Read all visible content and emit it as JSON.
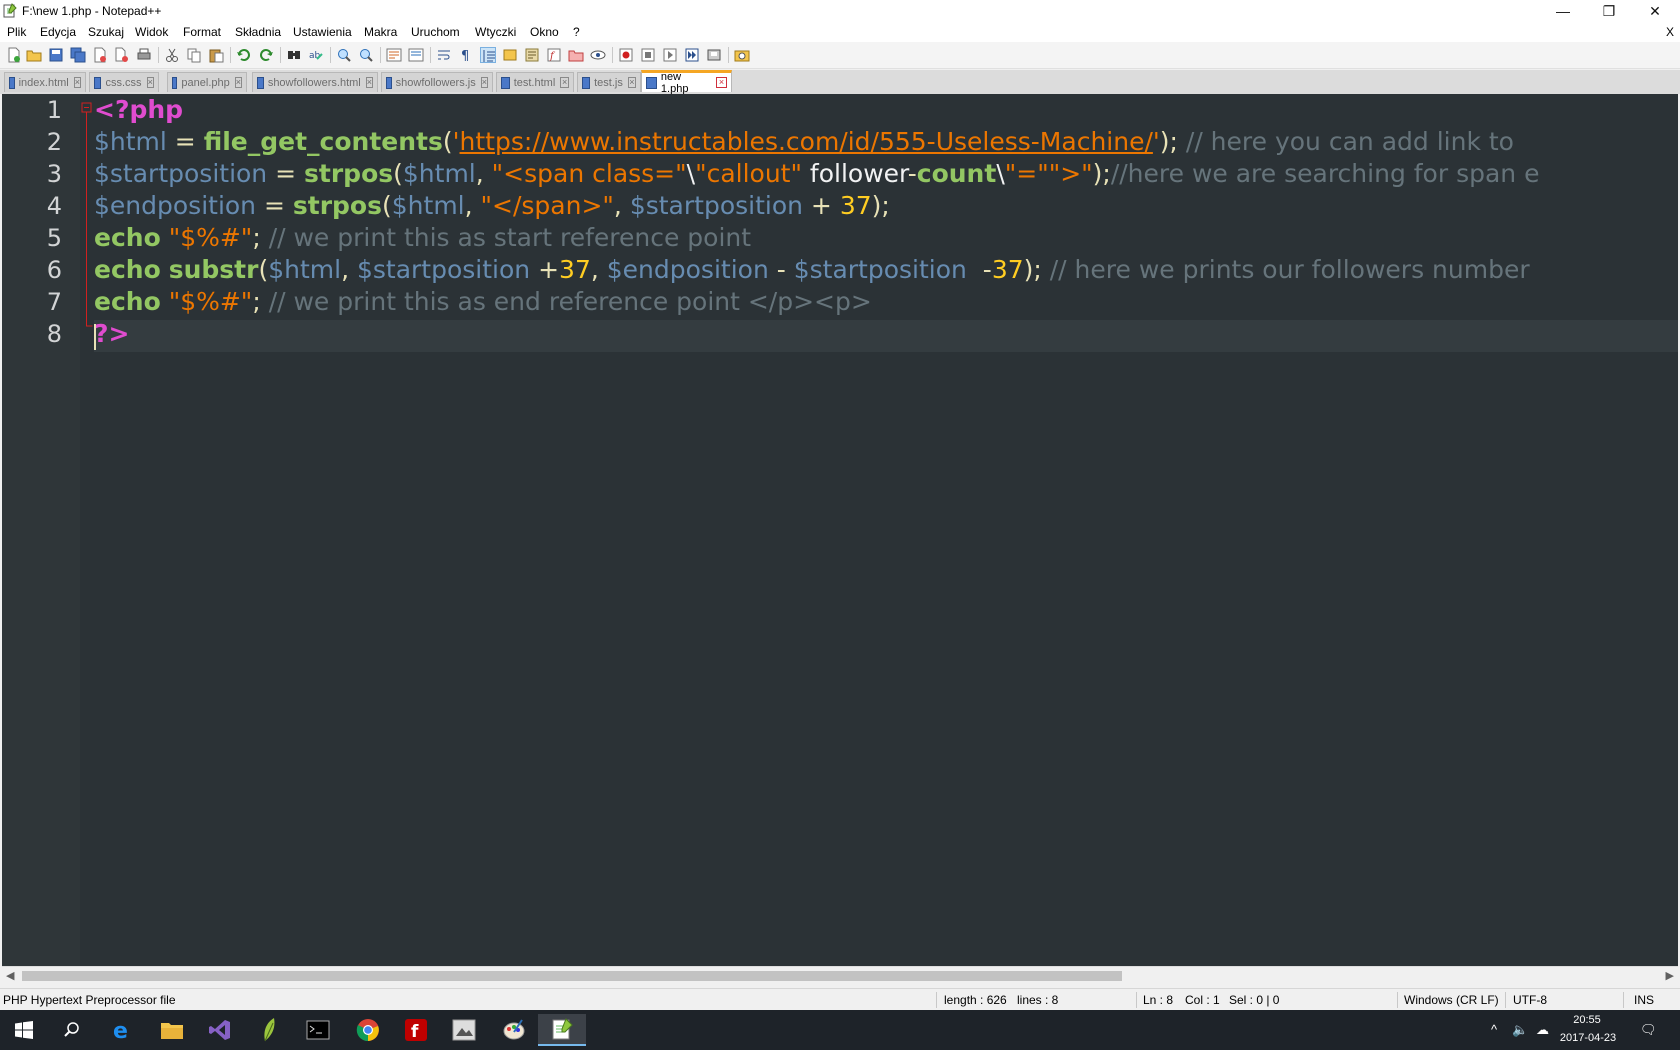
{
  "window": {
    "title": "F:\\new 1.php - Notepad++",
    "minimize_glyph": "—",
    "maximize_glyph": "❐",
    "close_glyph": "✕"
  },
  "menu": {
    "items": [
      "Plik",
      "Edycja",
      "Szukaj",
      "Widok",
      "Format",
      "Składnia",
      "Ustawienia",
      "Makra",
      "Uruchom",
      "Wtyczki",
      "Okno",
      "?"
    ],
    "close_label": "X"
  },
  "tabs": [
    {
      "label": "index.html",
      "active": false
    },
    {
      "label": "css.css",
      "active": false
    },
    {
      "label": "panel.php",
      "active": false
    },
    {
      "label": "showfollowers.html",
      "active": false
    },
    {
      "label": "showfollowers.js",
      "active": false
    },
    {
      "label": "test.html",
      "active": false
    },
    {
      "label": "test.js",
      "active": false
    },
    {
      "label": "new 1.php",
      "active": true
    }
  ],
  "editor": {
    "line_numbers": [
      "1",
      "2",
      "3",
      "4",
      "5",
      "6",
      "7",
      "8"
    ],
    "current_line": 8,
    "lines": [
      [
        {
          "t": "<?php",
          "c": "tag"
        }
      ],
      [
        {
          "t": "$html",
          "c": "var"
        },
        {
          "t": " = ",
          "c": "op"
        },
        {
          "t": "file_get_contents",
          "c": "kw"
        },
        {
          "t": "(",
          "c": "op"
        },
        {
          "t": "'",
          "c": "str"
        },
        {
          "t": "https://www.instructables.com/id/555-Useless-Machine/",
          "c": "url"
        },
        {
          "t": "'",
          "c": "str"
        },
        {
          "t": "); ",
          "c": "op"
        },
        {
          "t": "// here you can add link to",
          "c": "cmt"
        }
      ],
      [
        {
          "t": "$startposition",
          "c": "var"
        },
        {
          "t": " = ",
          "c": "op"
        },
        {
          "t": "strpos",
          "c": "kw"
        },
        {
          "t": "(",
          "c": "op"
        },
        {
          "t": "$html",
          "c": "var"
        },
        {
          "t": ", ",
          "c": "op"
        },
        {
          "t": "\"<span class=\"",
          "c": "str"
        },
        {
          "t": "\\",
          "c": "txt"
        },
        {
          "t": "\"callout\"",
          "c": "str"
        },
        {
          "t": " follower",
          "c": "txt"
        },
        {
          "t": "-",
          "c": "op"
        },
        {
          "t": "count",
          "c": "kw"
        },
        {
          "t": "\\",
          "c": "txt"
        },
        {
          "t": "\"=\"\">\"",
          "c": "str"
        },
        {
          "t": ");",
          "c": "op"
        },
        {
          "t": "//here we are searching for span e",
          "c": "cmt"
        }
      ],
      [
        {
          "t": "$endposition",
          "c": "var"
        },
        {
          "t": " = ",
          "c": "op"
        },
        {
          "t": "strpos",
          "c": "kw"
        },
        {
          "t": "(",
          "c": "op"
        },
        {
          "t": "$html",
          "c": "var"
        },
        {
          "t": ", ",
          "c": "op"
        },
        {
          "t": "\"</span>\"",
          "c": "str"
        },
        {
          "t": ", ",
          "c": "op"
        },
        {
          "t": "$startposition",
          "c": "var"
        },
        {
          "t": " + ",
          "c": "op"
        },
        {
          "t": "37",
          "c": "num"
        },
        {
          "t": ");",
          "c": "op"
        }
      ],
      [
        {
          "t": "echo",
          "c": "kw"
        },
        {
          "t": " ",
          "c": "op"
        },
        {
          "t": "\"$%#\"",
          "c": "str"
        },
        {
          "t": "; ",
          "c": "op"
        },
        {
          "t": "// we print this as start reference point",
          "c": "cmt"
        }
      ],
      [
        {
          "t": "echo",
          "c": "kw"
        },
        {
          "t": " ",
          "c": "op"
        },
        {
          "t": "substr",
          "c": "kw"
        },
        {
          "t": "(",
          "c": "op"
        },
        {
          "t": "$html",
          "c": "var"
        },
        {
          "t": ", ",
          "c": "op"
        },
        {
          "t": "$startposition",
          "c": "var"
        },
        {
          "t": " +",
          "c": "op"
        },
        {
          "t": "37",
          "c": "num"
        },
        {
          "t": ", ",
          "c": "op"
        },
        {
          "t": "$endposition",
          "c": "var"
        },
        {
          "t": " - ",
          "c": "op"
        },
        {
          "t": "$startposition",
          "c": "var"
        },
        {
          "t": "  -",
          "c": "op"
        },
        {
          "t": "37",
          "c": "num"
        },
        {
          "t": "); ",
          "c": "op"
        },
        {
          "t": "// here we prints our followers number",
          "c": "cmt"
        }
      ],
      [
        {
          "t": "echo",
          "c": "kw"
        },
        {
          "t": " ",
          "c": "op"
        },
        {
          "t": "\"$%#\"",
          "c": "str"
        },
        {
          "t": "; ",
          "c": "op"
        },
        {
          "t": "// we print this as end reference point </p><p>",
          "c": "cmt"
        }
      ],
      [
        {
          "t": "?>",
          "c": "tag"
        }
      ]
    ]
  },
  "status": {
    "file_type": "PHP Hypertext Preprocessor file",
    "length": "length : 626",
    "lines": "lines : 8",
    "ln": "Ln : 8",
    "col": "Col : 1",
    "sel": "Sel : 0 | 0",
    "eol": "Windows (CR LF)",
    "encoding": "UTF-8",
    "mode": "INS"
  },
  "taskbar": {
    "time": "20:55",
    "date": "2017-04-23",
    "apps": [
      "start-icon",
      "search-icon",
      "edge-icon",
      "file-explorer-icon",
      "visual-studio-icon",
      "feather-app-icon",
      "cmd-icon",
      "chrome-icon",
      "filezilla-icon",
      "app-icon",
      "paint-icon",
      "notepadpp-icon"
    ]
  },
  "colors": {
    "editor_bg": "#2b3236",
    "keyword": "#93c763",
    "variable": "#678cb1",
    "string": "#ec7600",
    "number": "#ffcd22",
    "php_tag": "#e04ccf",
    "comment": "#66747b",
    "active_tab_accent": "#f5a623"
  }
}
